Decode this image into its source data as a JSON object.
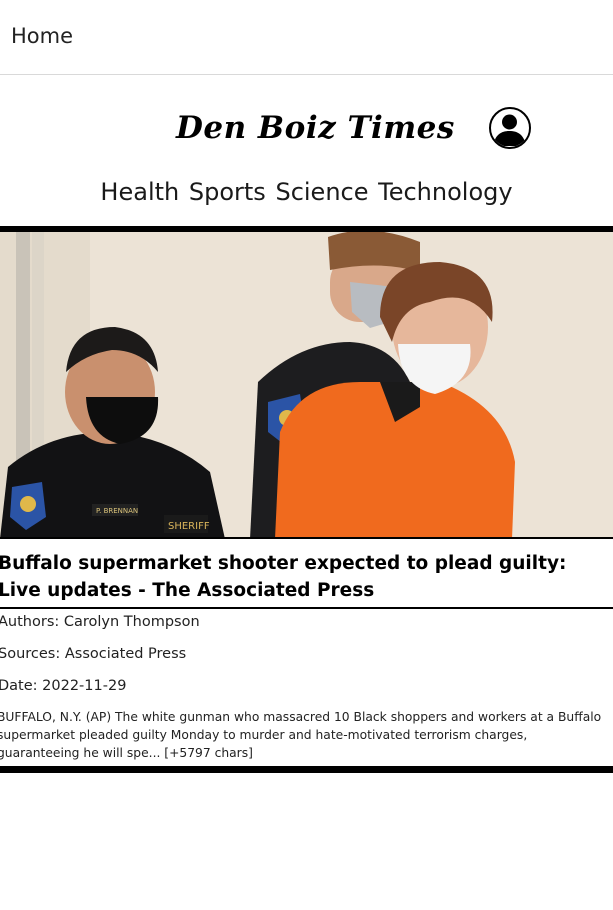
{
  "topbar": {
    "home_label": "Home"
  },
  "masthead": {
    "title": "Den Boiz Times",
    "profile_icon": "user-circle-icon"
  },
  "nav": {
    "items": [
      "Health",
      "Sports",
      "Science",
      "Technology"
    ]
  },
  "article": {
    "headline": "Buffalo supermarket shooter expected to plead guilty: Live updates - The Associated Press",
    "authors": "Authors: Carolyn Thompson",
    "sources": "Sources: Associated Press",
    "date": "Date: 2022-11-29",
    "summary": "BUFFALO, N.Y. (AP) The white gunman who massacred 10 Black shoppers and workers at a Buffalo supermarket pleaded guilty Monday to murder and hate-motivated terrorism charges, guaranteeing he will spe... [+5797 chars]",
    "image_badge_left": "P. BRENNAN",
    "image_badge_right": "SHERIFF"
  },
  "colors": {
    "accent": "#000000",
    "prisoner_jumpsuit": "#f06a1e",
    "wall": "#ece3d6"
  }
}
